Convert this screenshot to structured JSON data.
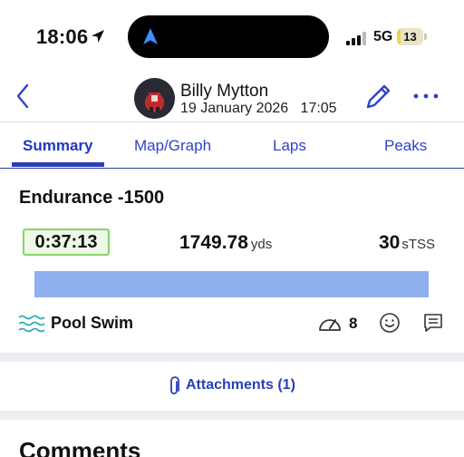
{
  "status_bar": {
    "time": "18:06",
    "network": "5G",
    "battery": "13",
    "battery_level": 0.13
  },
  "header": {
    "user_name": "Billy Mytton",
    "date_time": "19 January 2026   17:05"
  },
  "tabs": [
    {
      "label": "Summary",
      "active": true
    },
    {
      "label": "Map/Graph",
      "active": false
    },
    {
      "label": "Laps",
      "active": false
    },
    {
      "label": "Peaks",
      "active": false
    }
  ],
  "workout": {
    "title": "Endurance -1500",
    "duration": "0:37:13",
    "distance_value": "1749.78",
    "distance_unit": "yds",
    "tss_value": "30",
    "tss_unit": "sTSS",
    "progress": 1.0,
    "sport": "Pool Swim",
    "rpe": "8"
  },
  "attachments": {
    "label": "Attachments (1)"
  },
  "comments": {
    "heading": "Comments"
  },
  "colors": {
    "accent": "#2a3eb8",
    "duration_border": "#8bd36a",
    "bar": "#8fb0ee",
    "band": "#eceef2"
  },
  "icons": [
    "location-arrow-icon",
    "navigation-icon",
    "signal-icon",
    "battery-icon",
    "back-chevron-icon",
    "edit-pencil-icon",
    "more-ellipsis-icon",
    "swim-waves-icon",
    "gauge-icon",
    "smiley-icon",
    "comment-icon",
    "paperclip-icon"
  ]
}
